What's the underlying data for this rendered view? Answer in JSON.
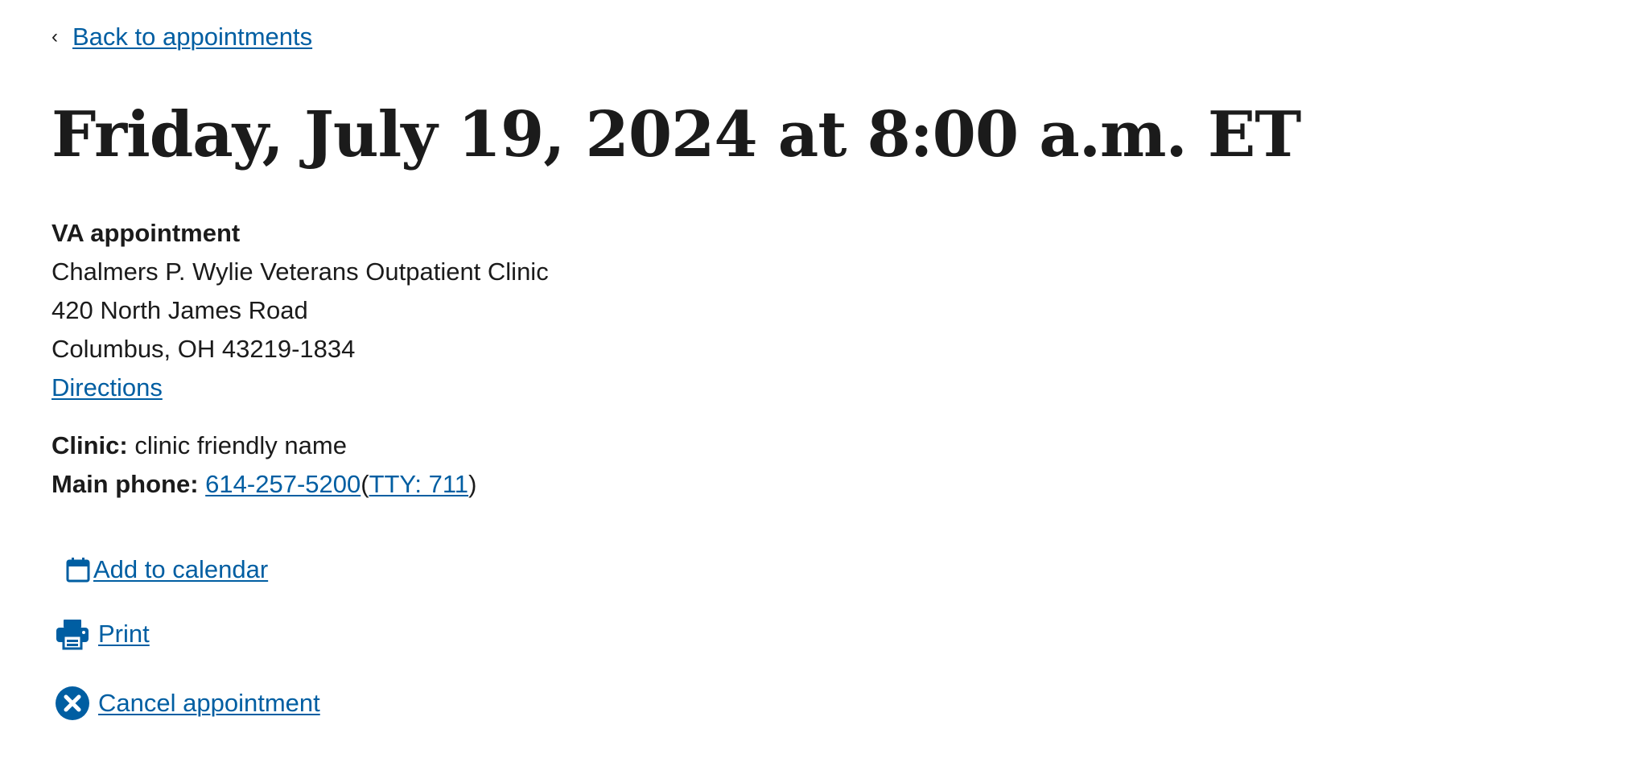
{
  "nav": {
    "back_label": "Back to appointments"
  },
  "header": {
    "title": "Friday, July 19, 2024 at 8:00 a.m. ET"
  },
  "appointment": {
    "type": "VA appointment",
    "facility_name": "Chalmers P. Wylie Veterans Outpatient Clinic",
    "street": "420 North James Road",
    "city_state_zip": "Columbus, OH 43219-1834",
    "directions_label": "Directions"
  },
  "clinic": {
    "label": "Clinic:",
    "name": "clinic friendly name",
    "phone_label": "Main phone:",
    "phone": "614-257-5200",
    "tty": "TTY: 711"
  },
  "actions": {
    "add_to_calendar": "Add to calendar",
    "print": "Print",
    "cancel": "Cancel appointment"
  },
  "colors": {
    "link": "#005ea2",
    "text": "#1b1b1b",
    "background": "#ffffff"
  },
  "icons": {
    "back": "chevron-left-icon",
    "calendar": "calendar-icon",
    "print": "printer-icon",
    "cancel": "cancel-circle-icon"
  }
}
